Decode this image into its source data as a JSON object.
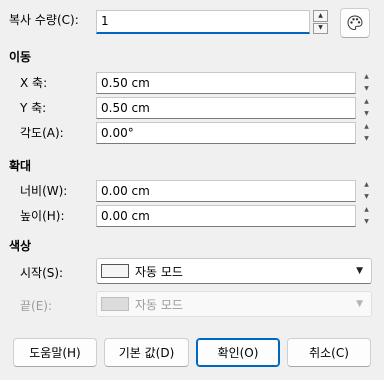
{
  "copies": {
    "label": "복사 수량(C):",
    "value": "1"
  },
  "move": {
    "title": "이동",
    "x": {
      "label": "X 축:",
      "value": "0.50 cm"
    },
    "y": {
      "label": "Y 축:",
      "value": "0.50 cm"
    },
    "angle": {
      "label": "각도(A):",
      "value": "0.00°"
    }
  },
  "enlarge": {
    "title": "확대",
    "width": {
      "label": "너비(W):",
      "value": "0.00 cm"
    },
    "height": {
      "label": "높이(H):",
      "value": "0.00 cm"
    }
  },
  "colors": {
    "title": "색상",
    "start": {
      "label": "시작(S):",
      "value": "자동 모드",
      "swatch": "#f5f5f5"
    },
    "end": {
      "label": "끝(E):",
      "value": "자동 모드",
      "swatch": "#dcdcdc"
    }
  },
  "buttons": {
    "help": "도움말(H)",
    "defaults": "기본 값(D)",
    "ok": "확인(O)",
    "cancel": "취소(C)"
  },
  "accent_color": "#0067c0"
}
